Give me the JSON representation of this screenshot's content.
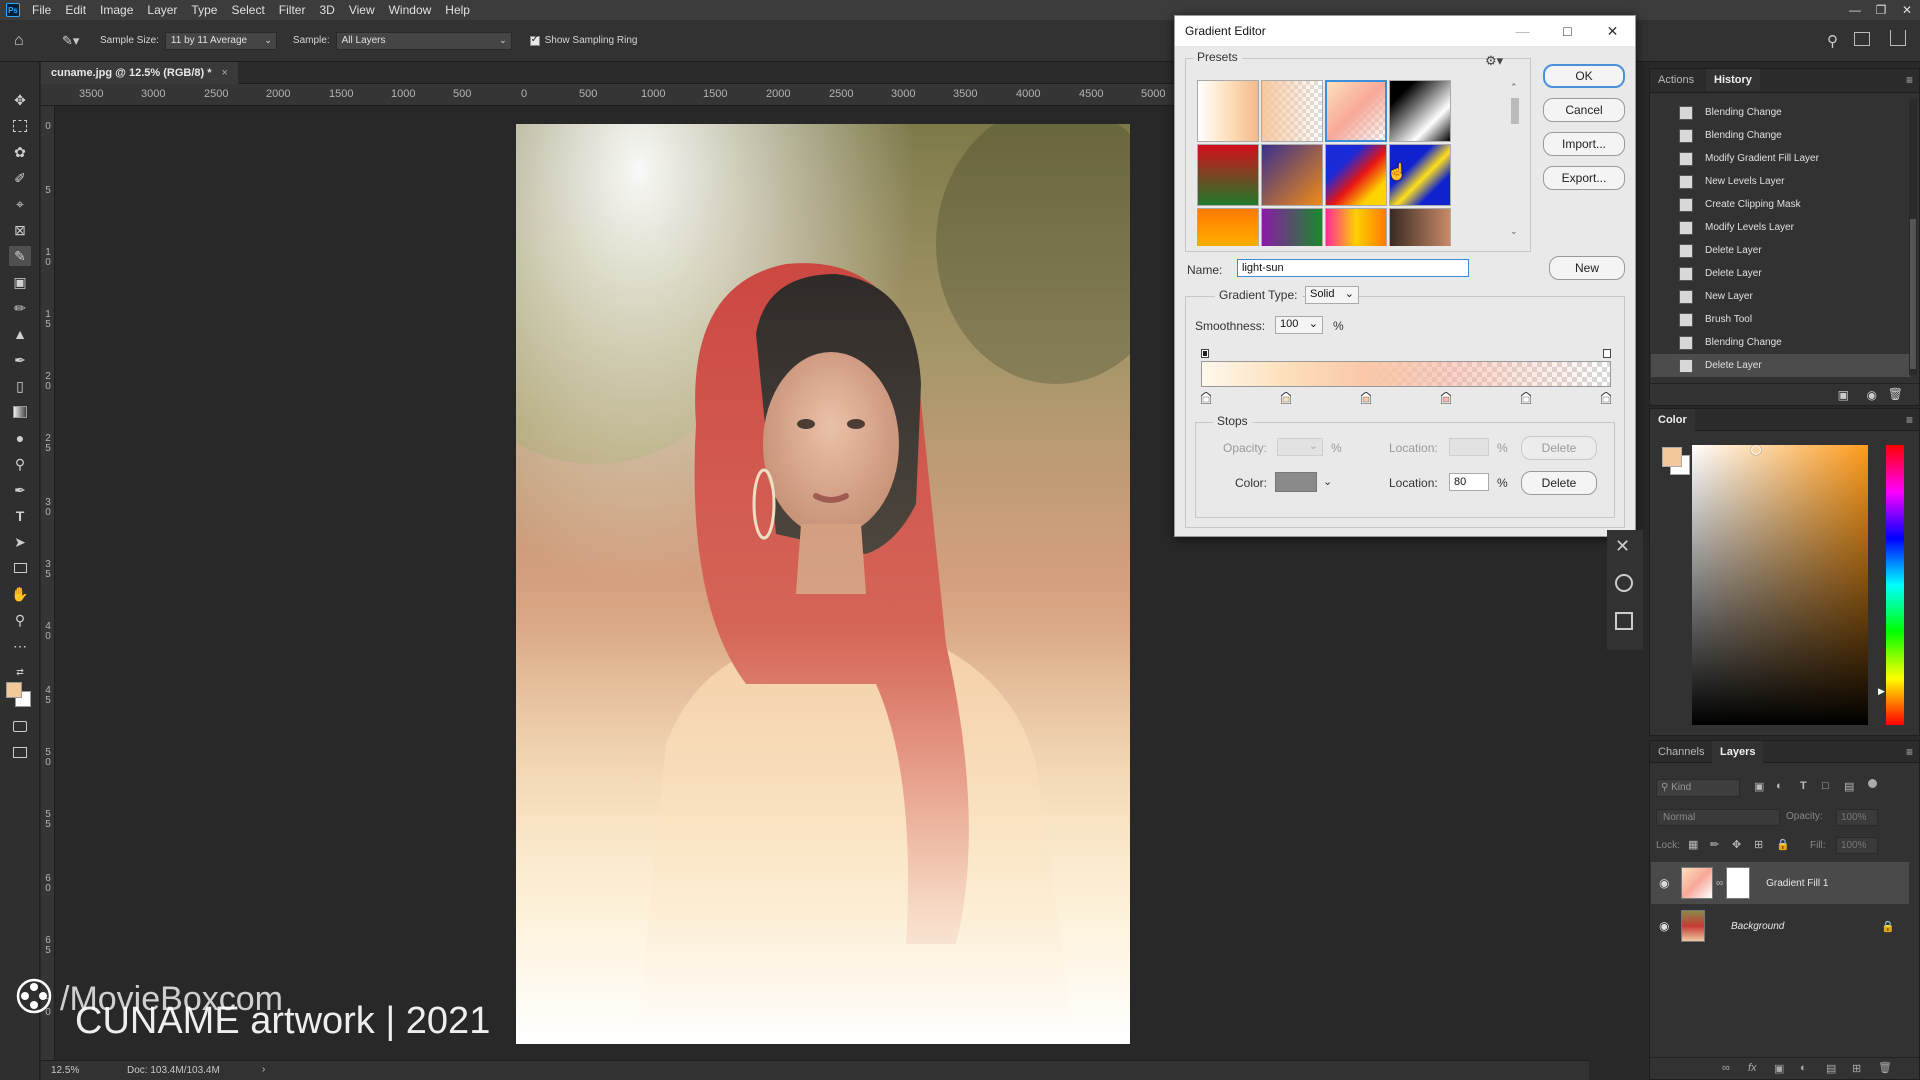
{
  "menubar": {
    "logo": "Ps",
    "items": [
      "File",
      "Edit",
      "Image",
      "Layer",
      "Type",
      "Select",
      "Filter",
      "3D",
      "View",
      "Window",
      "Help"
    ]
  },
  "options_bar": {
    "sample_size_label": "Sample Size:",
    "sample_size_value": "11 by 11 Average",
    "sample_label": "Sample:",
    "sample_value": "All Layers",
    "show_sampling_ring": "Show Sampling Ring"
  },
  "document": {
    "tab_title": "cuname.jpg @ 12.5% (RGB/8) *",
    "ruler_h": [
      "3500",
      "3000",
      "2500",
      "2000",
      "1500",
      "1000",
      "500",
      "0",
      "500",
      "1000",
      "1500",
      "2000",
      "2500",
      "3000",
      "3500",
      "4000",
      "4500",
      "5000"
    ],
    "ruler_v": [
      "0",
      "5",
      "1 0",
      "1 5",
      "2 0",
      "2 5",
      "3 0",
      "3 5",
      "4 0",
      "4 5",
      "5 0",
      "5 5",
      "6 0",
      "6 5",
      "7 0"
    ],
    "zoom": "12.5%",
    "doc_size": "Doc: 103.4M/103.4M"
  },
  "watermark": {
    "line1": "/MovieBoxcom",
    "line2": "CUNAME artwork | 2021"
  },
  "gradient_editor": {
    "title": "Gradient Editor",
    "presets_label": "Presets",
    "buttons": {
      "ok": "OK",
      "cancel": "Cancel",
      "import": "Import...",
      "export": "Export...",
      "new": "New"
    },
    "name_label": "Name:",
    "name_value": "light-sun",
    "gradient_type_label": "Gradient Type:",
    "gradient_type_value": "Solid",
    "smoothness_label": "Smoothness:",
    "smoothness_value": "100",
    "percent": "%",
    "stops_label": "Stops",
    "opacity_label": "Opacity:",
    "location_label": "Location:",
    "delete_label": "Delete",
    "color_label": "Color:",
    "color_location_value": "80",
    "color_stop_locations_pct": [
      0,
      20,
      40,
      60,
      80,
      100
    ]
  },
  "history_panel": {
    "tabs": [
      "Actions",
      "History"
    ],
    "items": [
      "Blending Change",
      "Blending Change",
      "Modify Gradient Fill Layer",
      "New Levels Layer",
      "Create Clipping Mask",
      "Modify Levels Layer",
      "Delete Layer",
      "Delete Layer",
      "New Layer",
      "Brush Tool",
      "Blending Change",
      "Delete Layer"
    ]
  },
  "color_panel": {
    "tab": "Color",
    "foreground": "#f3c89a",
    "background": "#ffffff",
    "hue_color": "#ff9b1a"
  },
  "layers_panel": {
    "tabs": [
      "Channels",
      "Layers"
    ],
    "kind_placeholder": "Kind",
    "blend_mode": "Normal",
    "opacity_label": "Opacity:",
    "opacity_value": "100%",
    "lock_label": "Lock:",
    "fill_label": "Fill:",
    "fill_value": "100%",
    "layers": [
      {
        "name": "Gradient Fill 1"
      },
      {
        "name": "Background"
      }
    ]
  }
}
